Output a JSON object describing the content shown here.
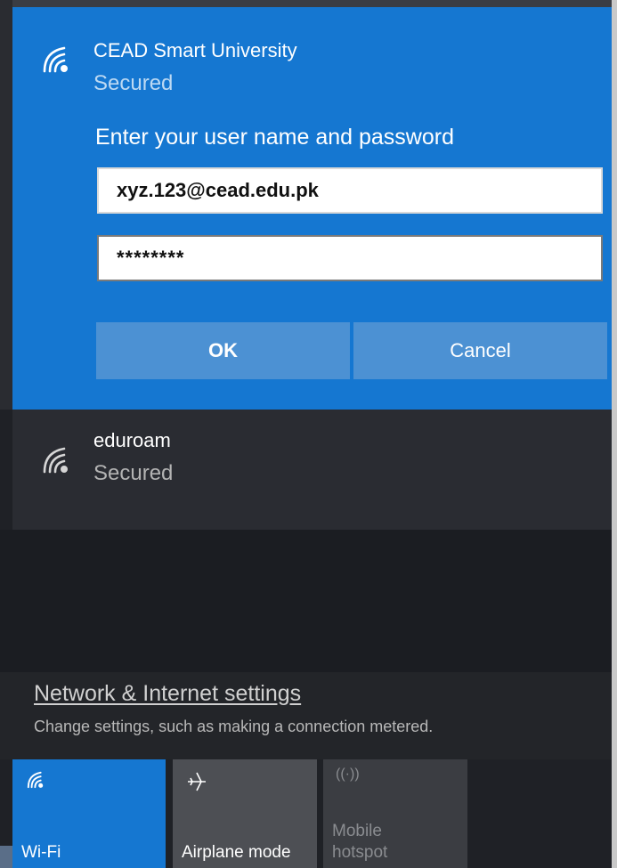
{
  "selected_network": {
    "name": "CEAD Smart University",
    "status": "Secured",
    "prompt": "Enter your user name and password",
    "username_value": "xyz.123@cead.edu.pk",
    "password_value": "********",
    "ok_label": "OK",
    "cancel_label": "Cancel",
    "icon": "wifi-icon"
  },
  "other_network": {
    "name": "eduroam",
    "status": "Secured",
    "icon": "wifi-icon"
  },
  "settings": {
    "link_label": "Network & Internet settings",
    "description": "Change settings, such as making a connection metered."
  },
  "quick_actions": [
    {
      "label": "Wi-Fi",
      "icon": "wifi-icon",
      "state": "on"
    },
    {
      "label": "Airplane mode",
      "icon": "airplane-icon",
      "state": "off"
    },
    {
      "label_line1": "Mobile",
      "label_line2": "hotspot",
      "icon": "hotspot-icon",
      "state": "disabled"
    }
  ],
  "colors": {
    "accent": "#1577d1",
    "button": "#4c91d3",
    "flyout_bg": "#1f2126"
  }
}
